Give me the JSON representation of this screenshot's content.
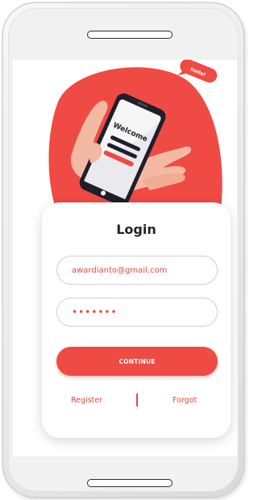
{
  "illustration": {
    "phone_screen_text": "Welcome",
    "speech_bubble_text": "Hello!"
  },
  "login": {
    "title": "Login",
    "email_value": "awardianto@gmail.com",
    "password_value": "•••••••",
    "continue_label": "CONTINUE",
    "register_label": "Register",
    "forgot_label": "Forgot"
  },
  "colors": {
    "accent": "#ef4a43",
    "text_dark": "#222222"
  }
}
